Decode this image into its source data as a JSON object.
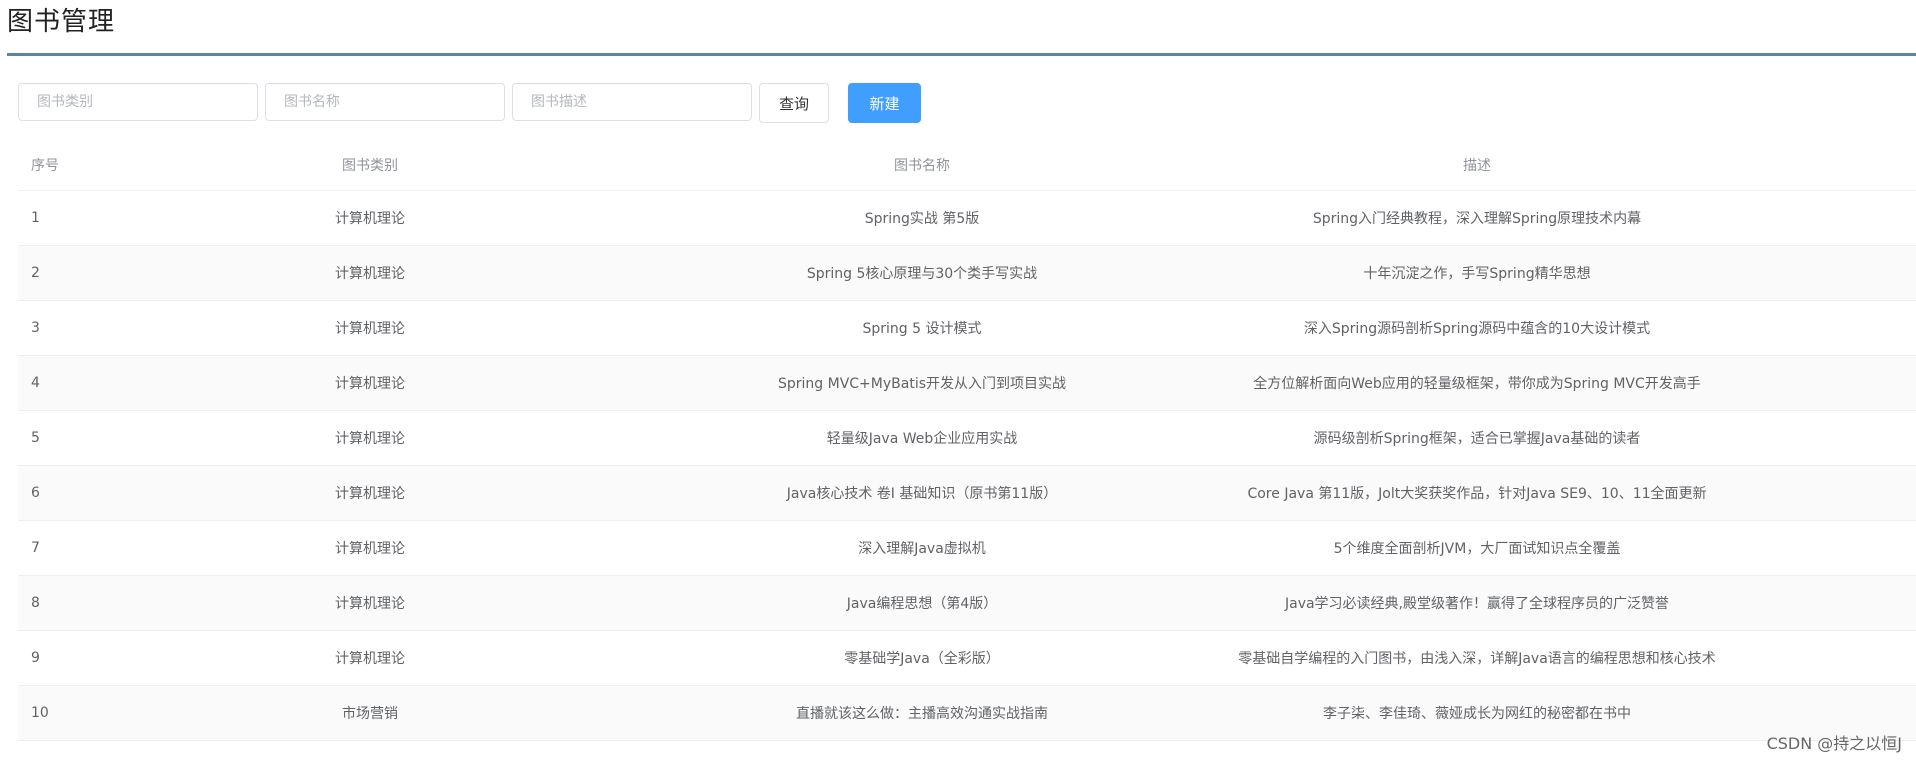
{
  "page": {
    "title": "图书管理"
  },
  "search": {
    "category_placeholder": "图书类别",
    "name_placeholder": "图书名称",
    "desc_placeholder": "图书描述",
    "query_label": "查询",
    "new_label": "新建"
  },
  "colors": {
    "primary": "#409eff",
    "title_rule": "#5b86a3",
    "stripe": "#fafafa",
    "border": "#ebeef5"
  },
  "table": {
    "headers": {
      "index": "序号",
      "category": "图书类别",
      "name": "图书名称",
      "description": "描述"
    },
    "rows": [
      {
        "index": "1",
        "category": "计算机理论",
        "name": "Spring实战 第5版",
        "description": "Spring入门经典教程，深入理解Spring原理技术内幕"
      },
      {
        "index": "2",
        "category": "计算机理论",
        "name": "Spring 5核心原理与30个类手写实战",
        "description": "十年沉淀之作，手写Spring精华思想"
      },
      {
        "index": "3",
        "category": "计算机理论",
        "name": "Spring 5 设计模式",
        "description": "深入Spring源码剖析Spring源码中蕴含的10大设计模式"
      },
      {
        "index": "4",
        "category": "计算机理论",
        "name": "Spring MVC+MyBatis开发从入门到项目实战",
        "description": "全方位解析面向Web应用的轻量级框架，带你成为Spring MVC开发高手"
      },
      {
        "index": "5",
        "category": "计算机理论",
        "name": "轻量级Java Web企业应用实战",
        "description": "源码级剖析Spring框架，适合已掌握Java基础的读者"
      },
      {
        "index": "6",
        "category": "计算机理论",
        "name": "Java核心技术 卷I 基础知识（原书第11版）",
        "description": "Core Java 第11版，Jolt大奖获奖作品，针对Java SE9、10、11全面更新"
      },
      {
        "index": "7",
        "category": "计算机理论",
        "name": "深入理解Java虚拟机",
        "description": "5个维度全面剖析JVM，大厂面试知识点全覆盖"
      },
      {
        "index": "8",
        "category": "计算机理论",
        "name": "Java编程思想（第4版）",
        "description": "Java学习必读经典,殿堂级著作！赢得了全球程序员的广泛赞誉"
      },
      {
        "index": "9",
        "category": "计算机理论",
        "name": "零基础学Java（全彩版）",
        "description": "零基础自学编程的入门图书，由浅入深，详解Java语言的编程思想和核心技术"
      },
      {
        "index": "10",
        "category": "市场营销",
        "name": "直播就该这么做：主播高效沟通实战指南",
        "description": "李子柒、李佳琦、薇娅成长为网红的秘密都在书中"
      }
    ]
  },
  "watermark": "CSDN @持之以恒J"
}
